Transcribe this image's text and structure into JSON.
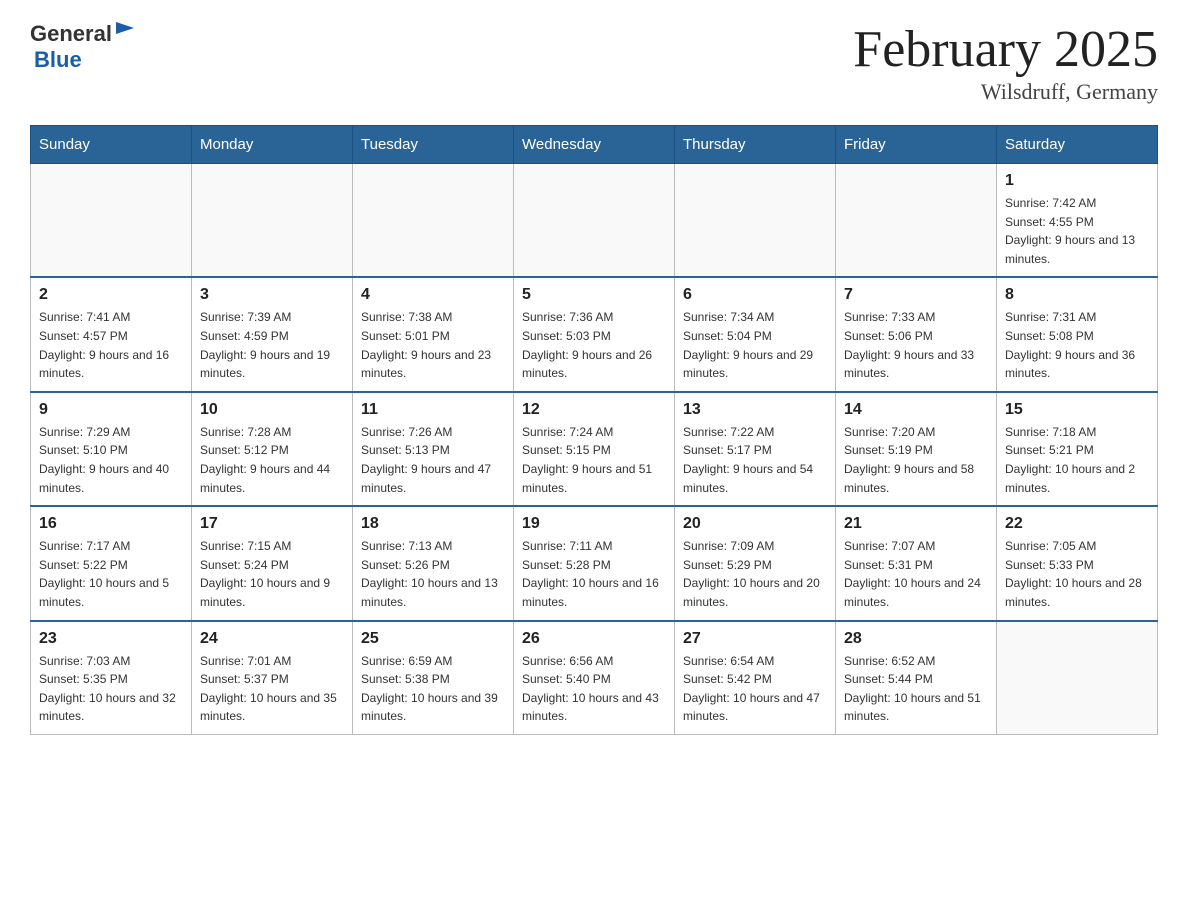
{
  "header": {
    "logo_general": "General",
    "logo_blue": "Blue",
    "month_title": "February 2025",
    "location": "Wilsdruff, Germany"
  },
  "days_of_week": [
    "Sunday",
    "Monday",
    "Tuesday",
    "Wednesday",
    "Thursday",
    "Friday",
    "Saturday"
  ],
  "weeks": [
    [
      null,
      null,
      null,
      null,
      null,
      null,
      {
        "day": "1",
        "sunrise": "Sunrise: 7:42 AM",
        "sunset": "Sunset: 4:55 PM",
        "daylight": "Daylight: 9 hours and 13 minutes."
      }
    ],
    [
      {
        "day": "2",
        "sunrise": "Sunrise: 7:41 AM",
        "sunset": "Sunset: 4:57 PM",
        "daylight": "Daylight: 9 hours and 16 minutes."
      },
      {
        "day": "3",
        "sunrise": "Sunrise: 7:39 AM",
        "sunset": "Sunset: 4:59 PM",
        "daylight": "Daylight: 9 hours and 19 minutes."
      },
      {
        "day": "4",
        "sunrise": "Sunrise: 7:38 AM",
        "sunset": "Sunset: 5:01 PM",
        "daylight": "Daylight: 9 hours and 23 minutes."
      },
      {
        "day": "5",
        "sunrise": "Sunrise: 7:36 AM",
        "sunset": "Sunset: 5:03 PM",
        "daylight": "Daylight: 9 hours and 26 minutes."
      },
      {
        "day": "6",
        "sunrise": "Sunrise: 7:34 AM",
        "sunset": "Sunset: 5:04 PM",
        "daylight": "Daylight: 9 hours and 29 minutes."
      },
      {
        "day": "7",
        "sunrise": "Sunrise: 7:33 AM",
        "sunset": "Sunset: 5:06 PM",
        "daylight": "Daylight: 9 hours and 33 minutes."
      },
      {
        "day": "8",
        "sunrise": "Sunrise: 7:31 AM",
        "sunset": "Sunset: 5:08 PM",
        "daylight": "Daylight: 9 hours and 36 minutes."
      }
    ],
    [
      {
        "day": "9",
        "sunrise": "Sunrise: 7:29 AM",
        "sunset": "Sunset: 5:10 PM",
        "daylight": "Daylight: 9 hours and 40 minutes."
      },
      {
        "day": "10",
        "sunrise": "Sunrise: 7:28 AM",
        "sunset": "Sunset: 5:12 PM",
        "daylight": "Daylight: 9 hours and 44 minutes."
      },
      {
        "day": "11",
        "sunrise": "Sunrise: 7:26 AM",
        "sunset": "Sunset: 5:13 PM",
        "daylight": "Daylight: 9 hours and 47 minutes."
      },
      {
        "day": "12",
        "sunrise": "Sunrise: 7:24 AM",
        "sunset": "Sunset: 5:15 PM",
        "daylight": "Daylight: 9 hours and 51 minutes."
      },
      {
        "day": "13",
        "sunrise": "Sunrise: 7:22 AM",
        "sunset": "Sunset: 5:17 PM",
        "daylight": "Daylight: 9 hours and 54 minutes."
      },
      {
        "day": "14",
        "sunrise": "Sunrise: 7:20 AM",
        "sunset": "Sunset: 5:19 PM",
        "daylight": "Daylight: 9 hours and 58 minutes."
      },
      {
        "day": "15",
        "sunrise": "Sunrise: 7:18 AM",
        "sunset": "Sunset: 5:21 PM",
        "daylight": "Daylight: 10 hours and 2 minutes."
      }
    ],
    [
      {
        "day": "16",
        "sunrise": "Sunrise: 7:17 AM",
        "sunset": "Sunset: 5:22 PM",
        "daylight": "Daylight: 10 hours and 5 minutes."
      },
      {
        "day": "17",
        "sunrise": "Sunrise: 7:15 AM",
        "sunset": "Sunset: 5:24 PM",
        "daylight": "Daylight: 10 hours and 9 minutes."
      },
      {
        "day": "18",
        "sunrise": "Sunrise: 7:13 AM",
        "sunset": "Sunset: 5:26 PM",
        "daylight": "Daylight: 10 hours and 13 minutes."
      },
      {
        "day": "19",
        "sunrise": "Sunrise: 7:11 AM",
        "sunset": "Sunset: 5:28 PM",
        "daylight": "Daylight: 10 hours and 16 minutes."
      },
      {
        "day": "20",
        "sunrise": "Sunrise: 7:09 AM",
        "sunset": "Sunset: 5:29 PM",
        "daylight": "Daylight: 10 hours and 20 minutes."
      },
      {
        "day": "21",
        "sunrise": "Sunrise: 7:07 AM",
        "sunset": "Sunset: 5:31 PM",
        "daylight": "Daylight: 10 hours and 24 minutes."
      },
      {
        "day": "22",
        "sunrise": "Sunrise: 7:05 AM",
        "sunset": "Sunset: 5:33 PM",
        "daylight": "Daylight: 10 hours and 28 minutes."
      }
    ],
    [
      {
        "day": "23",
        "sunrise": "Sunrise: 7:03 AM",
        "sunset": "Sunset: 5:35 PM",
        "daylight": "Daylight: 10 hours and 32 minutes."
      },
      {
        "day": "24",
        "sunrise": "Sunrise: 7:01 AM",
        "sunset": "Sunset: 5:37 PM",
        "daylight": "Daylight: 10 hours and 35 minutes."
      },
      {
        "day": "25",
        "sunrise": "Sunrise: 6:59 AM",
        "sunset": "Sunset: 5:38 PM",
        "daylight": "Daylight: 10 hours and 39 minutes."
      },
      {
        "day": "26",
        "sunrise": "Sunrise: 6:56 AM",
        "sunset": "Sunset: 5:40 PM",
        "daylight": "Daylight: 10 hours and 43 minutes."
      },
      {
        "day": "27",
        "sunrise": "Sunrise: 6:54 AM",
        "sunset": "Sunset: 5:42 PM",
        "daylight": "Daylight: 10 hours and 47 minutes."
      },
      {
        "day": "28",
        "sunrise": "Sunrise: 6:52 AM",
        "sunset": "Sunset: 5:44 PM",
        "daylight": "Daylight: 10 hours and 51 minutes."
      },
      null
    ]
  ]
}
